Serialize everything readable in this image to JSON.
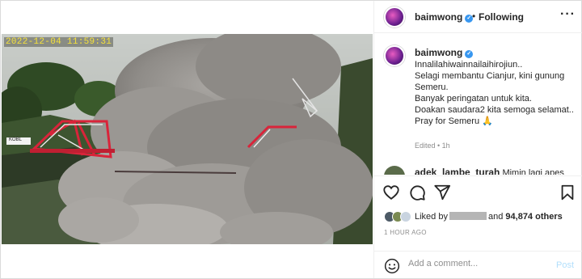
{
  "video": {
    "timestamp": "2022-12-04 11:59:31",
    "sign_text": "KOBL"
  },
  "header": {
    "username": "baimwong",
    "separator": "•",
    "follow_state": "Following",
    "more": "···"
  },
  "caption": {
    "username": "baimwong",
    "lines": [
      "Innalilahiwainnailaihirojiun..",
      "Selagi membantu Cianjur, kini gunung Semeru.",
      "Banyak peringatan untuk kita.",
      "Doakan saudara2 kita semoga selamat..",
      "Pray for Semeru 🙏"
    ],
    "meta": "Edited • 1h"
  },
  "comment_preview": {
    "username": "adek_lambe_turah",
    "text": "Mimin lagi apes"
  },
  "likes": {
    "prefix": "Liked by",
    "suffix_and": "and",
    "count": "94,874 others"
  },
  "post_time": "1 HOUR AGO",
  "add_comment": {
    "placeholder": "Add a comment...",
    "post_label": "Post"
  },
  "colors": {
    "verified": "#3897f0",
    "post_button": "#b2dffc",
    "timestamp": "#f5e23a",
    "bridge": "#d9243a"
  }
}
